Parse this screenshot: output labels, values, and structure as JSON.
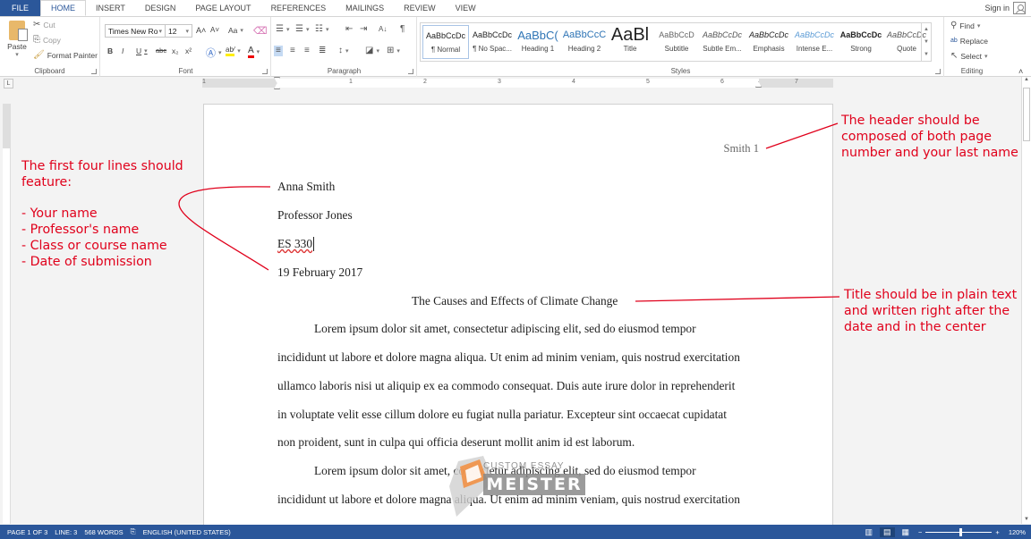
{
  "tabs": [
    "FILE",
    "HOME",
    "INSERT",
    "DESIGN",
    "PAGE LAYOUT",
    "REFERENCES",
    "MAILINGS",
    "REVIEW",
    "VIEW"
  ],
  "active_tab": "HOME",
  "signin": "Sign in",
  "clipboard": {
    "paste": "Paste",
    "cut": "Cut",
    "copy": "Copy",
    "format_painter": "Format Painter",
    "label": "Clipboard"
  },
  "font": {
    "name": "Times New Ro",
    "size": "12",
    "label": "Font",
    "bold": "B",
    "italic": "I",
    "underline": "U",
    "strike": "abc",
    "sub": "x₂",
    "sup": "x²",
    "grow": "A˄",
    "shrink": "A˅",
    "case": "Aa"
  },
  "paragraph": {
    "label": "Paragraph"
  },
  "styles": {
    "label": "Styles",
    "items": [
      {
        "preview": "AaBbCcDc",
        "name": "¶ Normal"
      },
      {
        "preview": "AaBbCcDc",
        "name": "¶ No Spac..."
      },
      {
        "preview": "AaBbC(",
        "name": "Heading 1"
      },
      {
        "preview": "AaBbCcC",
        "name": "Heading 2"
      },
      {
        "preview": "AaBl",
        "name": "Title"
      },
      {
        "preview": "AaBbCcD",
        "name": "Subtitle"
      },
      {
        "preview": "AaBbCcDc",
        "name": "Subtle Em..."
      },
      {
        "preview": "AaBbCcDc",
        "name": "Emphasis"
      },
      {
        "preview": "AaBbCcDc",
        "name": "Intense E..."
      },
      {
        "preview": "AaBbCcDc",
        "name": "Strong"
      },
      {
        "preview": "AaBbCcDc",
        "name": "Quote"
      }
    ]
  },
  "editing": {
    "find": "Find",
    "replace": "Replace",
    "select": "Select",
    "label": "Editing"
  },
  "ruler": {
    "numbers": [
      "1",
      "1",
      "2",
      "3",
      "4",
      "5",
      "6",
      "7"
    ]
  },
  "document": {
    "header": "Smith 1",
    "name": "Anna Smith",
    "professor": "Professor Jones",
    "course": "ES 330",
    "date": "19 February 2017",
    "title": "The Causes and Effects of Climate Change",
    "lines": [
      "Lorem ipsum dolor sit amet, consectetur adipiscing elit, sed do eiusmod tempor",
      "incididunt ut labore et dolore magna aliqua. Ut enim ad minim veniam, quis nostrud exercitation",
      "ullamco laboris nisi ut aliquip ex ea commodo consequat. Duis aute irure dolor in reprehenderit",
      "in voluptate velit esse cillum dolore eu fugiat nulla pariatur. Excepteur sint occaecat cupidatat",
      "non proident, sunt in culpa qui officia deserunt mollit anim id est laborum.",
      "Lorem ipsum dolor sit amet, consectetur adipiscing elit, sed do eiusmod tempor",
      "incididunt ut labore et dolore magna aliqua. Ut enim ad minim veniam, quis nostrud exercitation"
    ]
  },
  "annotations": {
    "header_note": "The header should be\ncomposed of both page\nnumber and your last name",
    "first_lines_note": "The first four lines should\nfeature:\n\n- Your name\n- Professor's name\n- Class or course name\n- Date of submission",
    "title_note": "Title should be in plain text\nand written right after the\ndate and in the center",
    "color": "#e0001b"
  },
  "watermark": {
    "top": "CUSTOM ESSAY",
    "brand": "MEISTER"
  },
  "status": {
    "page": "PAGE 1 OF 3",
    "line": "LINE: 3",
    "words": "568 WORDS",
    "language": "ENGLISH (UNITED STATES)",
    "zoom": "120%",
    "zoom_level_pct": 120
  }
}
